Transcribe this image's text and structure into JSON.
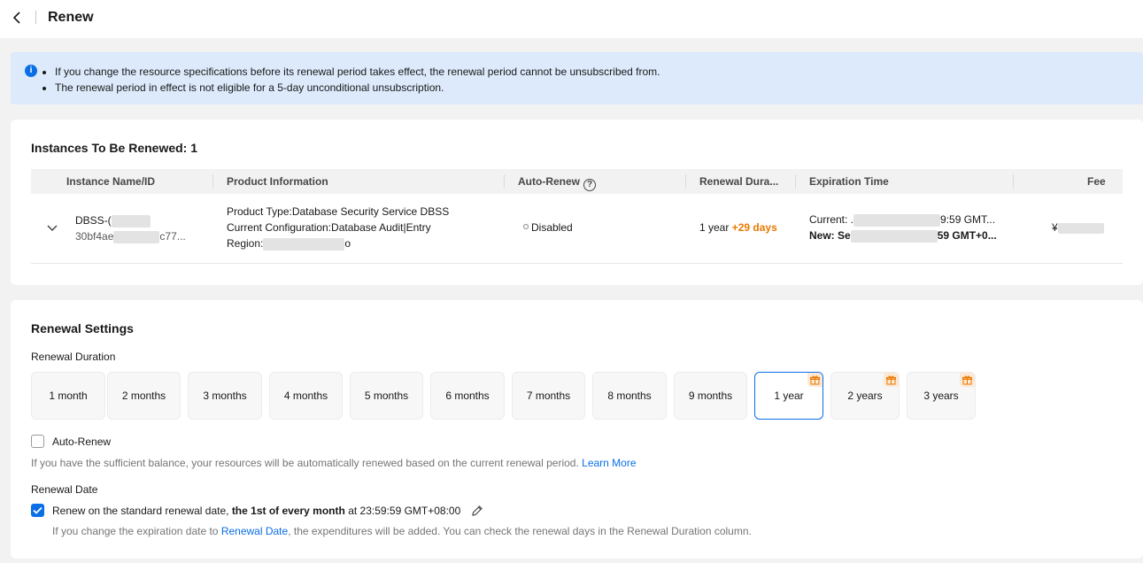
{
  "header": {
    "title": "Renew"
  },
  "notice": {
    "items": [
      "If you change the resource specifications before its renewal period takes effect, the renewal period cannot be unsubscribed from.",
      "The renewal period in effect is not eligible for a 5-day unconditional unsubscription."
    ]
  },
  "instances": {
    "title": "Instances To Be Renewed: 1",
    "columns": {
      "name": "Instance Name/ID",
      "product": "Product Information",
      "auto_renew": "Auto-Renew",
      "duration": "Renewal Dura...",
      "expiration": "Expiration Time",
      "fee": "Fee"
    },
    "row": {
      "name": "DBSS-(",
      "id_prefix": "30bf4ae",
      "id_suffix": "c77...",
      "product_type": "Product Type:Database Security Service DBSS",
      "configuration": "Current Configuration:Database Audit|Entry",
      "region_label": "Region:",
      "region_suffix": "o",
      "auto_renew": "Disabled",
      "duration": "1 year",
      "duration_bonus": "+29 days",
      "current_label": "Current: .",
      "current_suffix": "9:59 GMT...",
      "new_label": "New: Se",
      "new_suffix": "59 GMT+0...",
      "fee_prefix": "¥"
    }
  },
  "settings": {
    "title": "Renewal Settings",
    "duration_label": "Renewal Duration",
    "durations": [
      {
        "label": "1 month",
        "gift": false,
        "selected": false
      },
      {
        "label": "2 months",
        "gift": false,
        "selected": false
      },
      {
        "label": "3 months",
        "gift": false,
        "selected": false
      },
      {
        "label": "4 months",
        "gift": false,
        "selected": false
      },
      {
        "label": "5 months",
        "gift": false,
        "selected": false
      },
      {
        "label": "6 months",
        "gift": false,
        "selected": false
      },
      {
        "label": "7 months",
        "gift": false,
        "selected": false
      },
      {
        "label": "8 months",
        "gift": false,
        "selected": false
      },
      {
        "label": "9 months",
        "gift": false,
        "selected": false
      },
      {
        "label": "1 year",
        "gift": true,
        "selected": true
      },
      {
        "label": "2 years",
        "gift": true,
        "selected": false
      },
      {
        "label": "3 years",
        "gift": true,
        "selected": false
      }
    ],
    "auto_renew_label": "Auto-Renew",
    "auto_renew_checked": false,
    "auto_renew_hint": "If you have the sufficient balance, your resources will be automatically renewed based on the current renewal period.",
    "learn_more": "Learn More",
    "renewal_date_label": "Renewal Date",
    "renewal_date_checked": true,
    "renewal_date_text_1": "Renew on the standard renewal date,",
    "renewal_date_text_bold": "the 1st of every month",
    "renewal_date_text_2": "at 23:59:59 GMT+08:00",
    "renewal_hint_1": "If you change the expiration date to",
    "renewal_hint_link": "Renewal Date",
    "renewal_hint_2": ", the expenditures will be added. You can check the renewal days in the Renewal Duration column."
  },
  "colors": {
    "accent": "#0a6ee6",
    "gift": "#e87a00",
    "notice_bg": "#dceafb"
  }
}
